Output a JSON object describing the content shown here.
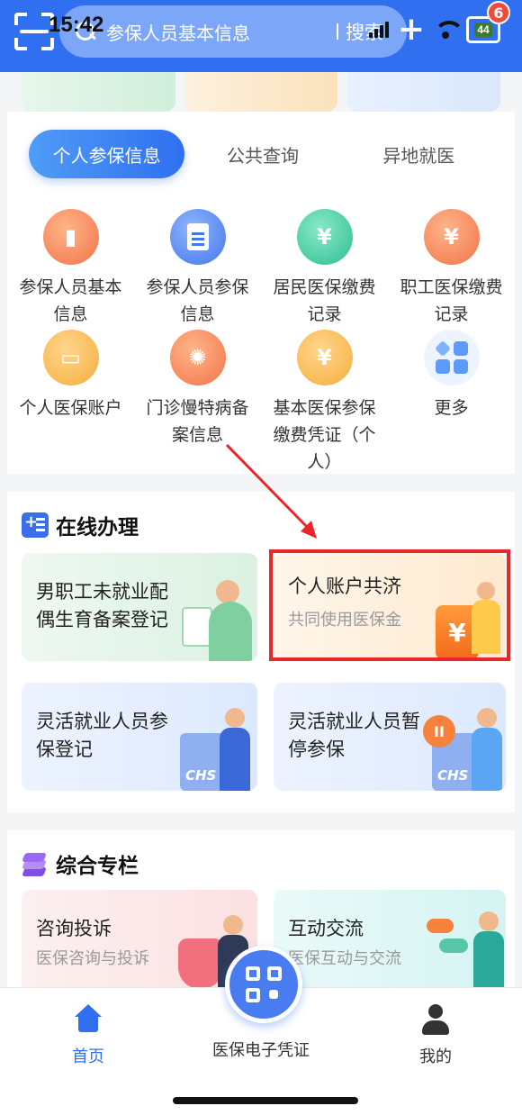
{
  "status": {
    "time": "15:42",
    "battery": "44",
    "notif_count": "6"
  },
  "search": {
    "placeholder": "参保人员基本信息",
    "button": "搜索"
  },
  "tabs": [
    "个人参保信息",
    "公共查询",
    "异地就医"
  ],
  "services": [
    {
      "label": "参保人员基本信息",
      "icon": "person-card-icon"
    },
    {
      "label": "参保人员参保信息",
      "icon": "document-icon"
    },
    {
      "label": "居民医保缴费记录",
      "icon": "yuan-receipt-icon"
    },
    {
      "label": "职工医保缴费记录",
      "icon": "yuan-receipt-icon"
    },
    {
      "label": "个人医保账户",
      "icon": "wallet-icon"
    },
    {
      "label": "门诊慢特病备案信息",
      "icon": "virus-icon"
    },
    {
      "label": "基本医保参保缴费凭证（个人）",
      "icon": "yuan-voucher-icon"
    },
    {
      "label": "更多",
      "icon": "more-grid-icon"
    }
  ],
  "online": {
    "title": "在线办理",
    "cards": [
      {
        "title": "男职工未就业配偶生育备案登记",
        "subtitle": ""
      },
      {
        "title": "个人账户共济",
        "subtitle": "共同使用医保金"
      },
      {
        "title": "灵活就业人员参保登记",
        "subtitle": ""
      },
      {
        "title": "灵活就业人员暂停参保",
        "subtitle": ""
      }
    ]
  },
  "comprehensive": {
    "title": "综合专栏",
    "cards": [
      {
        "title": "咨询投诉",
        "subtitle": "医保咨询与投诉"
      },
      {
        "title": "互动交流",
        "subtitle": "医保互动与交流"
      }
    ]
  },
  "nav": {
    "home": "首页",
    "voucher": "医保电子凭证",
    "mine": "我的"
  },
  "art_text": {
    "chs": "CHS",
    "yuan": "¥"
  },
  "colors": {
    "primary": "#2f6ff0",
    "highlight": "#e8272b"
  }
}
